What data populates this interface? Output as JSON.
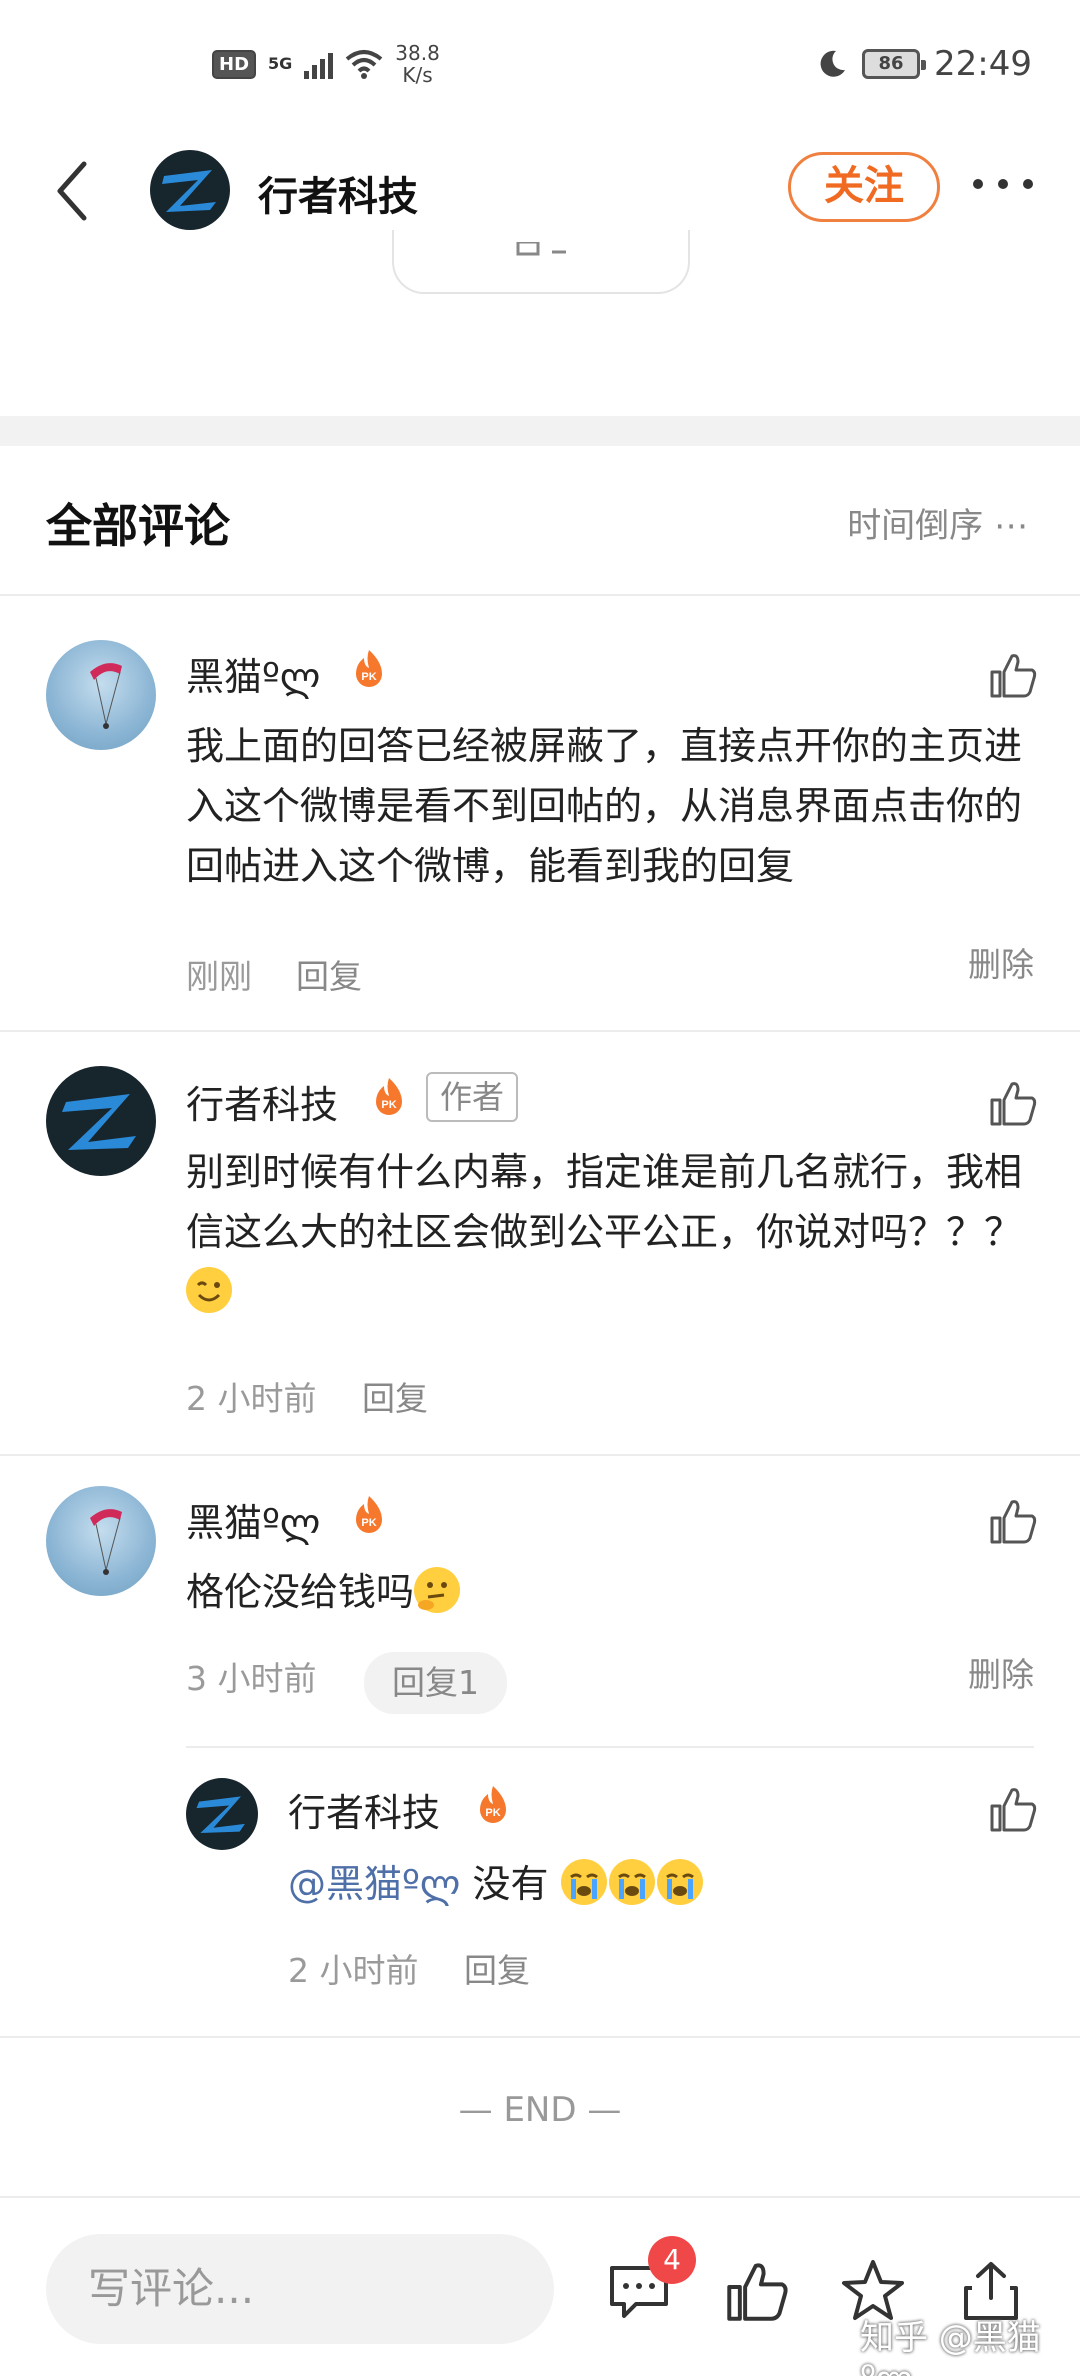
{
  "status_bar": {
    "hd": "HD",
    "network": "5G",
    "speed_value": "38.8",
    "speed_unit": "K/s",
    "battery": "86",
    "time": "22:49"
  },
  "nav": {
    "title": "行者科技",
    "follow_label": "关注"
  },
  "comments_header": {
    "title": "全部评论",
    "sort_label": "时间倒序 ⋯"
  },
  "comments": [
    {
      "username": "黑猫ºლ",
      "text": "我上面的回答已经被屏蔽了，直接点开你的主页进入这个微博是看不到回帖的，从消息界面点击你的回帖进入这个微博，能看到我的回复",
      "time": "刚刚",
      "reply_label": "回复",
      "delete_label": "删除"
    },
    {
      "username": "行者科技",
      "author_tag": "作者",
      "text": "别到时候有什么内幕，指定谁是前几名就行，我相信这么大的社区会做到公平公正，你说对吗？？？",
      "time": "2 小时前",
      "reply_label": "回复"
    },
    {
      "username": "黑猫ºლ",
      "text": "格伦没给钱吗",
      "time": "3 小时前",
      "reply_label": "回复1",
      "delete_label": "删除",
      "sub_reply": {
        "username": "行者科技",
        "mention": "@黑猫ºლ",
        "text": " 没有",
        "time": "2 小时前",
        "reply_label": "回复"
      }
    }
  ],
  "end_marker": "— END —",
  "bottom_bar": {
    "input_placeholder": "写评论...",
    "comment_count": "4",
    "watermark": "知乎 @黑猫ºლ"
  },
  "icons": {
    "back": "back-icon",
    "more": "more-icon",
    "like": "thumbs-up-icon",
    "comment": "comment-icon",
    "star": "star-icon",
    "share": "share-icon",
    "pk": "pk-flame-icon"
  },
  "colors": {
    "accent": "#f06a22",
    "mention": "#4f6fa8",
    "badge": "#f04848"
  }
}
